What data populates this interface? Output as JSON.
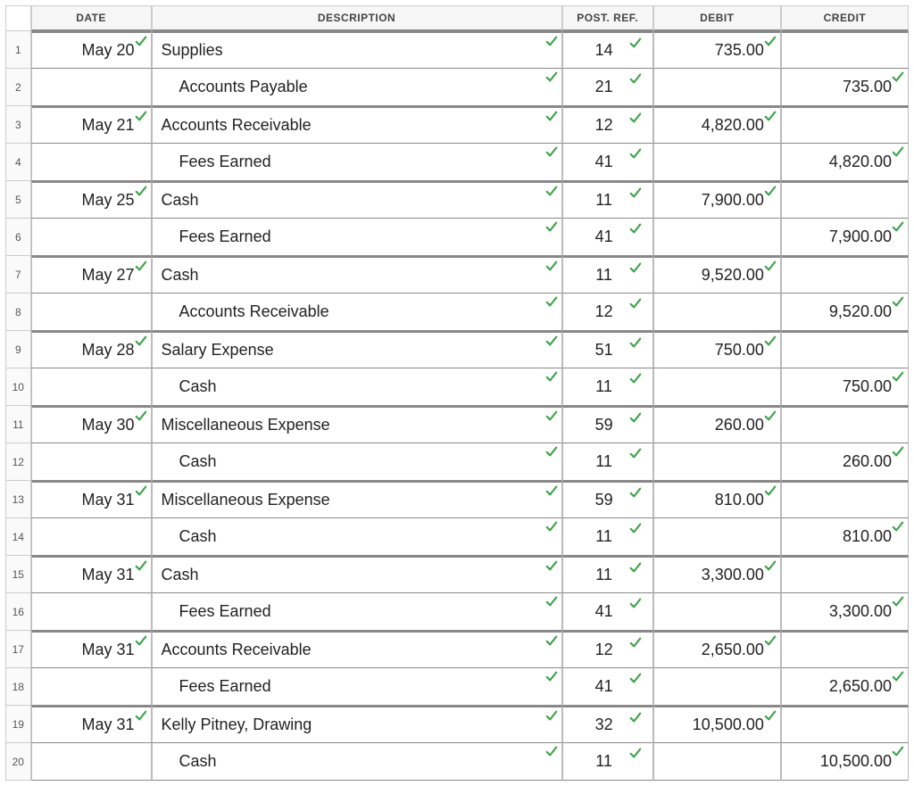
{
  "headers": {
    "num": "",
    "date": "DATE",
    "desc": "DESCRIPTION",
    "post": "POST. REF.",
    "debit": "DEBIT",
    "credit": "CREDIT"
  },
  "rows": [
    {
      "n": "1",
      "date": "May 20",
      "desc": "Supplies",
      "indent": false,
      "post": "14",
      "debit": "735.00",
      "credit": "",
      "pair_start": true
    },
    {
      "n": "2",
      "date": "",
      "desc": "Accounts Payable",
      "indent": true,
      "post": "21",
      "debit": "",
      "credit": "735.00",
      "pair_start": false
    },
    {
      "n": "3",
      "date": "May 21",
      "desc": "Accounts Receivable",
      "indent": false,
      "post": "12",
      "debit": "4,820.00",
      "credit": "",
      "pair_start": true
    },
    {
      "n": "4",
      "date": "",
      "desc": "Fees Earned",
      "indent": true,
      "post": "41",
      "debit": "",
      "credit": "4,820.00",
      "pair_start": false
    },
    {
      "n": "5",
      "date": "May 25",
      "desc": "Cash",
      "indent": false,
      "post": "11",
      "debit": "7,900.00",
      "credit": "",
      "pair_start": true
    },
    {
      "n": "6",
      "date": "",
      "desc": "Fees Earned",
      "indent": true,
      "post": "41",
      "debit": "",
      "credit": "7,900.00",
      "pair_start": false
    },
    {
      "n": "7",
      "date": "May 27",
      "desc": "Cash",
      "indent": false,
      "post": "11",
      "debit": "9,520.00",
      "credit": "",
      "pair_start": true
    },
    {
      "n": "8",
      "date": "",
      "desc": "Accounts Receivable",
      "indent": true,
      "post": "12",
      "debit": "",
      "credit": "9,520.00",
      "pair_start": false
    },
    {
      "n": "9",
      "date": "May 28",
      "desc": "Salary Expense",
      "indent": false,
      "post": "51",
      "debit": "750.00",
      "credit": "",
      "pair_start": true
    },
    {
      "n": "10",
      "date": "",
      "desc": "Cash",
      "indent": true,
      "post": "11",
      "debit": "",
      "credit": "750.00",
      "pair_start": false
    },
    {
      "n": "11",
      "date": "May 30",
      "desc": "Miscellaneous Expense",
      "indent": false,
      "post": "59",
      "debit": "260.00",
      "credit": "",
      "pair_start": true
    },
    {
      "n": "12",
      "date": "",
      "desc": "Cash",
      "indent": true,
      "post": "11",
      "debit": "",
      "credit": "260.00",
      "pair_start": false
    },
    {
      "n": "13",
      "date": "May 31",
      "desc": "Miscellaneous Expense",
      "indent": false,
      "post": "59",
      "debit": "810.00",
      "credit": "",
      "pair_start": true
    },
    {
      "n": "14",
      "date": "",
      "desc": "Cash",
      "indent": true,
      "post": "11",
      "debit": "",
      "credit": "810.00",
      "pair_start": false
    },
    {
      "n": "15",
      "date": "May 31",
      "desc": "Cash",
      "indent": false,
      "post": "11",
      "debit": "3,300.00",
      "credit": "",
      "pair_start": true
    },
    {
      "n": "16",
      "date": "",
      "desc": "Fees Earned",
      "indent": true,
      "post": "41",
      "debit": "",
      "credit": "3,300.00",
      "pair_start": false
    },
    {
      "n": "17",
      "date": "May 31",
      "desc": "Accounts Receivable",
      "indent": false,
      "post": "12",
      "debit": "2,650.00",
      "credit": "",
      "pair_start": true
    },
    {
      "n": "18",
      "date": "",
      "desc": "Fees Earned",
      "indent": true,
      "post": "41",
      "debit": "",
      "credit": "2,650.00",
      "pair_start": false
    },
    {
      "n": "19",
      "date": "May 31",
      "desc": "Kelly Pitney, Drawing",
      "indent": false,
      "post": "32",
      "debit": "10,500.00",
      "credit": "",
      "pair_start": true
    },
    {
      "n": "20",
      "date": "",
      "desc": "Cash",
      "indent": true,
      "post": "11",
      "debit": "",
      "credit": "10,500.00",
      "pair_start": false
    }
  ]
}
